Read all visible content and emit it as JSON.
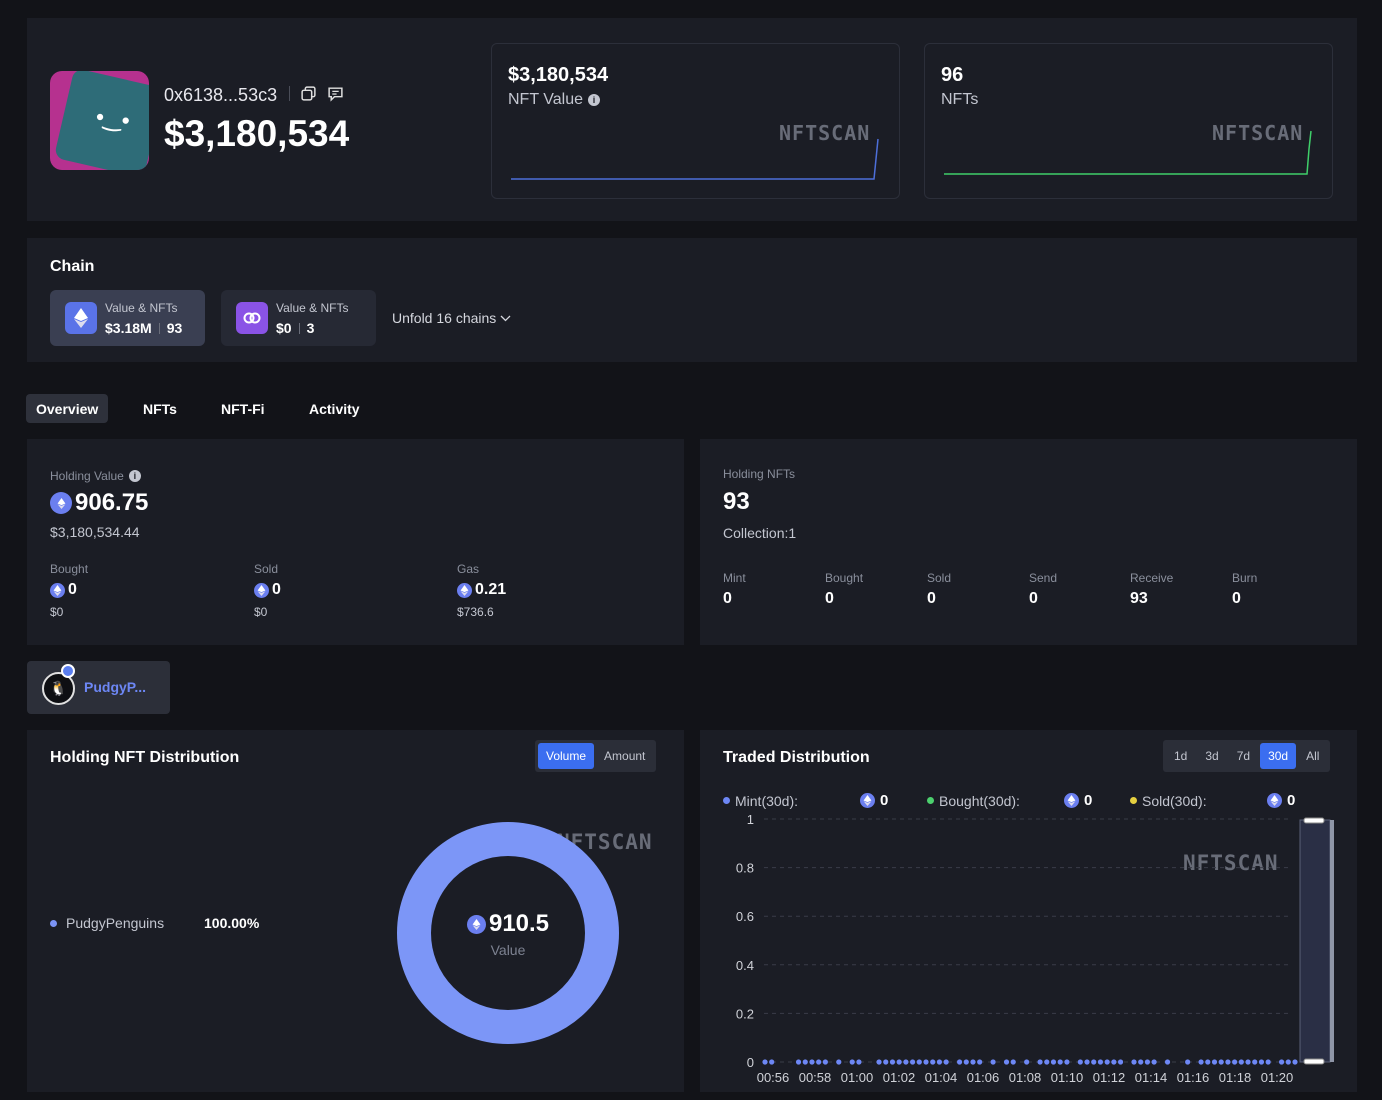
{
  "header": {
    "address": "0x6138...53c3",
    "total_value": "$3,180,534",
    "cards": [
      {
        "value": "$3,180,534",
        "label": "NFT Value",
        "watermark": "NFTSCAN",
        "line_color": "#4d6fd9"
      },
      {
        "value": "96",
        "label": "NFTs",
        "watermark": "NFTSCAN",
        "line_color": "#3fcf6a"
      }
    ]
  },
  "chain": {
    "title": "Chain",
    "chains": [
      {
        "label": "Value & NFTs",
        "value": "$3.18M",
        "count": "93",
        "icon": "ethereum-icon",
        "active": true
      },
      {
        "label": "Value & NFTs",
        "value": "$0",
        "count": "3",
        "icon": "polygon-icon",
        "active": false
      }
    ],
    "unfold_label": "Unfold 16 chains"
  },
  "tabs": [
    "Overview",
    "NFTs",
    "NFT-Fi",
    "Activity"
  ],
  "holding_value": {
    "label": "Holding Value",
    "eth": "906.75",
    "usd": "$3,180,534.44",
    "stats": [
      {
        "label": "Bought",
        "eth": "0",
        "usd": "$0"
      },
      {
        "label": "Sold",
        "eth": "0",
        "usd": "$0"
      },
      {
        "label": "Gas",
        "eth": "0.21",
        "usd": "$736.6"
      }
    ]
  },
  "holding_nfts": {
    "label": "Holding NFTs",
    "count": "93",
    "collection": "Collection:1",
    "stats": [
      {
        "label": "Mint",
        "value": "0"
      },
      {
        "label": "Bought",
        "value": "0"
      },
      {
        "label": "Sold",
        "value": "0"
      },
      {
        "label": "Send",
        "value": "0"
      },
      {
        "label": "Receive",
        "value": "93"
      },
      {
        "label": "Burn",
        "value": "0"
      }
    ]
  },
  "collection_chip": {
    "name": "PudgyP..."
  },
  "distribution": {
    "title": "Holding NFT Distribution",
    "toggle": [
      "Volume",
      "Amount"
    ],
    "legend_name": "PudgyPenguins",
    "legend_pct": "100.00%",
    "center_value": "910.5",
    "center_label": "Value",
    "watermark": "NFTSCAN"
  },
  "traded": {
    "title": "Traded Distribution",
    "ranges": [
      "1d",
      "3d",
      "7d",
      "30d",
      "All"
    ],
    "legend": [
      {
        "label": "Mint(30d):",
        "value": "0",
        "color": "#6d87f5"
      },
      {
        "label": "Bought(30d):",
        "value": "0",
        "color": "#4cd06e"
      },
      {
        "label": "Sold(30d):",
        "value": "0",
        "color": "#e6d040"
      }
    ],
    "watermark": "NFTSCAN"
  },
  "chart_data": {
    "type": "scatter",
    "title": "Traded Distribution",
    "ylim": [
      0,
      1
    ],
    "yticks": [
      "1",
      "0.8",
      "0.6",
      "0.4",
      "0.2",
      "0"
    ],
    "xticks": [
      "00:56",
      "00:58",
      "01:00",
      "01:02",
      "01:04",
      "01:06",
      "01:08",
      "01:10",
      "01:12",
      "01:14",
      "01:16",
      "01:18",
      "01:20"
    ],
    "series": [
      {
        "name": "Mint(30d):",
        "values": [
          0,
          0,
          0,
          0,
          0,
          0,
          0,
          0,
          0,
          0,
          0,
          0,
          0,
          0,
          0,
          0,
          0,
          0,
          0,
          0,
          0,
          0,
          0,
          0,
          0,
          0,
          0,
          0,
          0,
          0,
          0,
          0,
          0,
          0,
          0,
          0,
          0,
          0,
          0,
          0,
          0,
          0,
          0,
          0,
          0,
          0,
          0,
          0,
          0,
          0,
          0,
          0,
          0,
          0,
          0,
          0,
          0,
          0,
          0,
          0,
          0,
          0,
          0,
          0,
          0,
          0,
          0,
          0,
          0,
          0,
          0,
          0,
          0,
          0,
          0,
          0,
          0,
          0,
          0,
          0
        ]
      }
    ]
  }
}
